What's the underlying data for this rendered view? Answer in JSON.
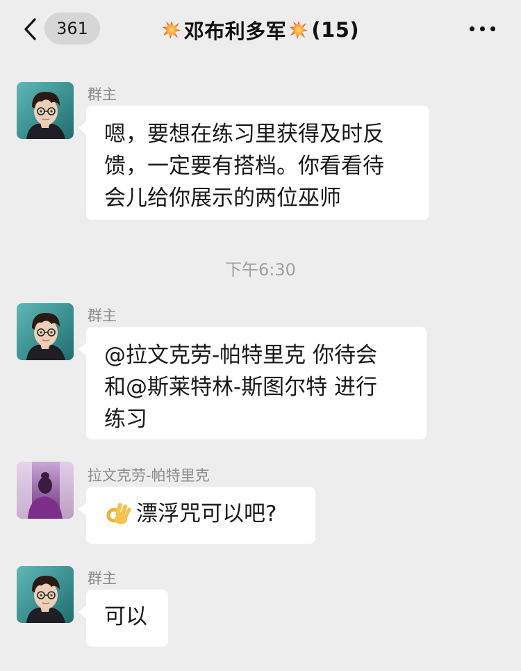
{
  "header": {
    "back_icon": "chevron-left-icon",
    "unread_count": "361",
    "title_emoji": "collision-emoji",
    "title_name": "邓布利多军",
    "member_count": "(15)",
    "more_icon": "more-dots-icon",
    "colors": {
      "background": "#ededed",
      "pill": "#d6d6d6"
    }
  },
  "messages": [
    {
      "sender": "群主",
      "avatar": "harry-avatar",
      "lines": [
        "嗯，要想在练习里获得及时反",
        "馈，一定要有搭档。你看看待",
        "会儿给你展示的两位巫师"
      ]
    },
    {
      "sender": "群主",
      "avatar": "harry-avatar",
      "lines": [
        "@拉文克劳-帕特里克 你待会",
        "和@斯莱特林-斯图尔特 进行",
        "练习"
      ]
    },
    {
      "sender": "拉文克劳-帕特里克",
      "avatar": "purple-figure-avatar",
      "emoji": "ok-hand-emoji",
      "text": "漂浮咒可以吧?"
    },
    {
      "sender": "群主",
      "avatar": "harry-avatar",
      "text": "可以"
    }
  ],
  "timestamp": "下午6:30",
  "colors": {
    "bubble": "#ffffff",
    "sender_text": "#8a8a8a",
    "timestamp_text": "#a0a0a0"
  }
}
